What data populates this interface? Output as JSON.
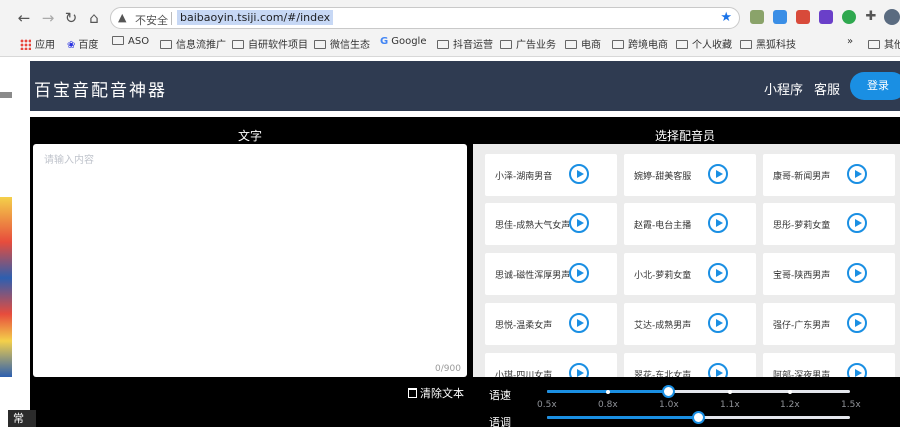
{
  "browser": {
    "insecure_label": "不安全",
    "url": "baibaoyin.tsiji.com/#/index",
    "bookmarks": [
      "应用",
      "百度",
      "ASO",
      "信息流推广",
      "自研软件项目",
      "微信生态",
      "Google",
      "抖音运营",
      "广告业务",
      "电商",
      "跨境电商",
      "个人收藏",
      "黑狐科技"
    ],
    "overflow": "»",
    "other_bookmarks": "其他"
  },
  "app": {
    "title": "百宝音配音神器",
    "nav": {
      "miniprogram": "小程序",
      "service": "客服"
    },
    "login": "登录"
  },
  "text_panel": {
    "header": "文字",
    "placeholder": "请输入内容",
    "counter": "0/900",
    "clear": "清除文本"
  },
  "voice_panel": {
    "header": "选择配音员",
    "voices": [
      "小泽-湖南男音",
      "婉婷-甜美客服",
      "康哥-新闻男声",
      "思佳-成熟大气女声",
      "赵霞-电台主播",
      "思彤-萝莉女童",
      "思诚-磁性浑厚男声",
      "小北-萝莉女童",
      "宝哥-陕西男声",
      "思悦-温柔女声",
      "艾达-成熟男声",
      "强仔-广东男声",
      "小琪-四川女声",
      "翠花-东北女声",
      "阿部-深夜男声"
    ]
  },
  "controls": {
    "speed_label": "语速",
    "pitch_label": "语调",
    "ticks": [
      "0.5x",
      "0.8x",
      "1.0x",
      "1.1x",
      "1.2x",
      "1.5x"
    ],
    "speed_value": "1.0x",
    "pitch_value": "1.1x"
  },
  "colors": {
    "header_bg": "#2f3b51",
    "accent": "#1a8fe3",
    "workspace_bg": "#000000"
  },
  "taskbar": {
    "chip": "常"
  }
}
